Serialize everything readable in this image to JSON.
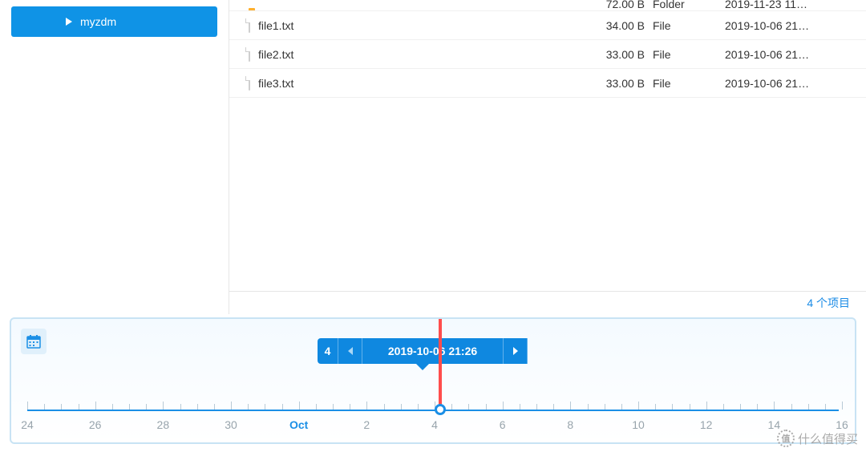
{
  "sidebar": {
    "items": [
      {
        "label": "myzdm"
      }
    ]
  },
  "files": {
    "rows": [
      {
        "name": "",
        "size": "72.00 B",
        "type": "Folder",
        "date": "2019-11-23 11…",
        "icon": "folder"
      },
      {
        "name": "file1.txt",
        "size": "34.00 B",
        "type": "File",
        "date": "2019-10-06 21…",
        "icon": "file"
      },
      {
        "name": "file2.txt",
        "size": "33.00 B",
        "type": "File",
        "date": "2019-10-06 21…",
        "icon": "file"
      },
      {
        "name": "file3.txt",
        "size": "33.00 B",
        "type": "File",
        "date": "2019-10-06 21…",
        "icon": "file"
      }
    ]
  },
  "footer": {
    "item_count": "4 个项目"
  },
  "timeline": {
    "snapshot_count": "4",
    "current_label": "2019-10-06 21:26",
    "month_label": "Oct",
    "ticks": [
      "24",
      "26",
      "28",
      "30",
      "Oct",
      "2",
      "4",
      "6",
      "8",
      "10",
      "12",
      "14",
      "16"
    ]
  },
  "watermark": {
    "badge": "值",
    "text": "什么值得买"
  }
}
